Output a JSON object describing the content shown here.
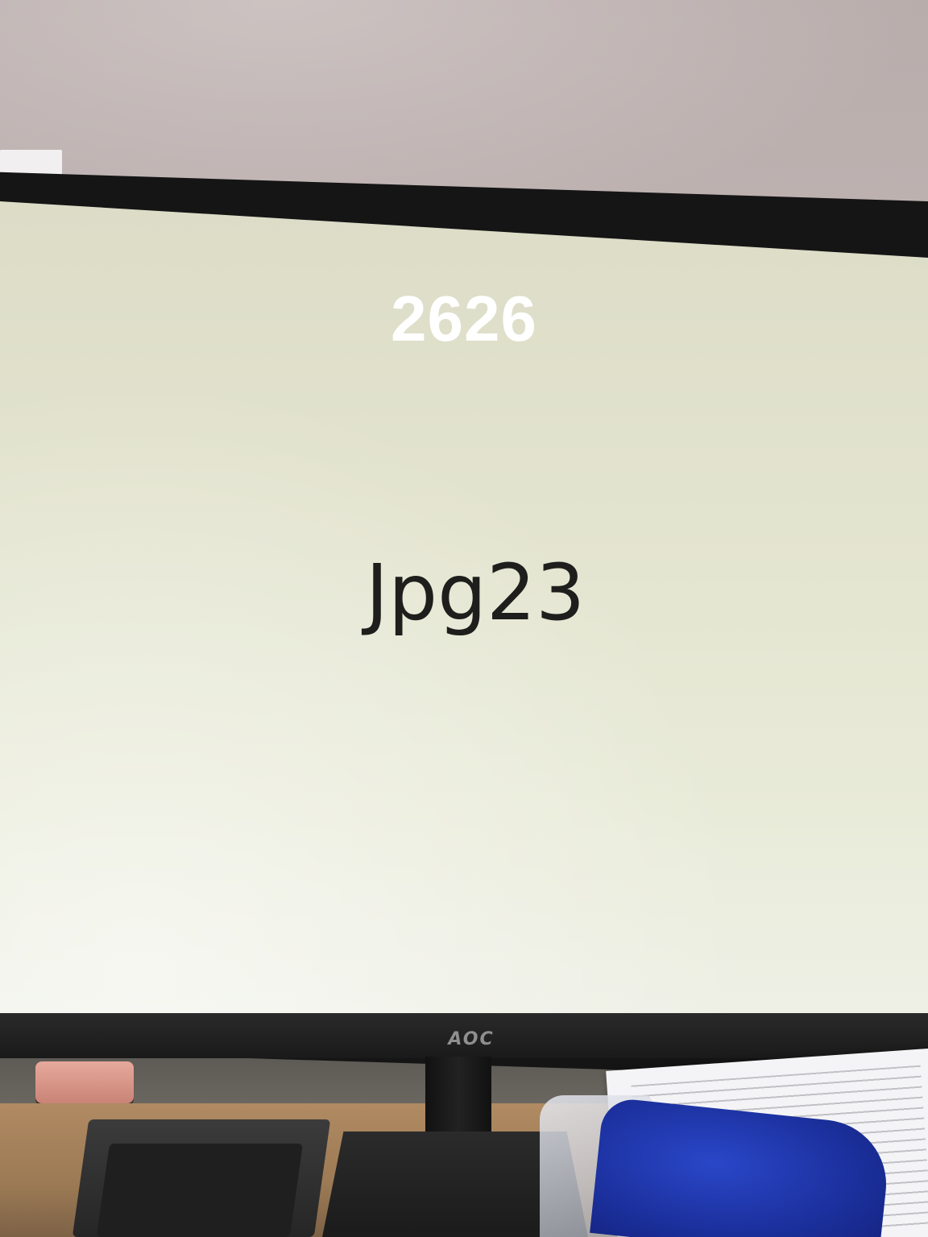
{
  "overlay": {
    "number": "2626"
  },
  "screen": {
    "text": "Jpg23"
  },
  "monitor": {
    "brand": "AOC"
  },
  "colors": {
    "screen_background": "#e3e4cf",
    "screen_text": "#1e1f1c",
    "overlay_text": "#ffffff",
    "bezel": "#151515"
  }
}
